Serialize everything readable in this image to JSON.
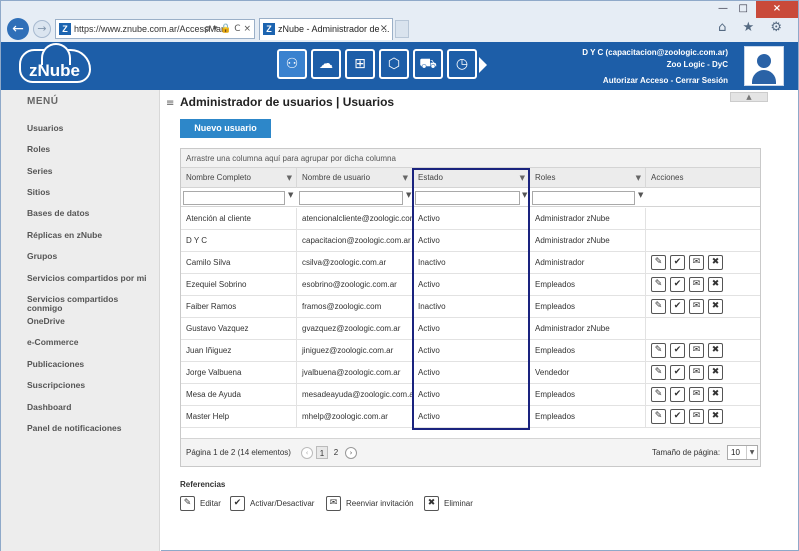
{
  "browser": {
    "url": "https://www.znube.com.ar/AccessMar",
    "tab_title": "zNube - Administrador de ...",
    "tab_close": "×",
    "back": "←",
    "forward": "→",
    "url_controls": "ρ ▾ 🔒 C ×",
    "right_icons": "⌂ ★ ⚙",
    "win_close": "×",
    "win_min": "—",
    "win_max": "□"
  },
  "header": {
    "brand": "zNube",
    "user_email": "D Y C (capacitacion@zoologic.com.ar)",
    "company": "Zoo Logic - DyC",
    "link_authorize": "Autorizar Acceso",
    "link_sep": " - ",
    "link_logout": "Cerrar Sesión",
    "modules": [
      {
        "icon": "users-globe-icon",
        "glyph": "⚇"
      },
      {
        "icon": "cloud-gear-icon",
        "glyph": "☁"
      },
      {
        "icon": "org-chart-icon",
        "glyph": "⊞"
      },
      {
        "icon": "cube-icon",
        "glyph": "⬡"
      },
      {
        "icon": "cart-icon",
        "glyph": "⛟"
      },
      {
        "icon": "clock-icon",
        "glyph": "◷"
      }
    ]
  },
  "sidebar": {
    "title": "MENÚ",
    "items": [
      "Usuarios",
      "Roles",
      "Series",
      "Sitios",
      "Bases de datos",
      "Réplicas en zNube",
      "Grupos",
      "Servicios compartidos por mi",
      "Servicios compartidos conmigo",
      "OneDrive",
      "e-Commerce",
      "Publicaciones",
      "Suscripciones",
      "Dashboard",
      "Panel de notificaciones"
    ]
  },
  "main": {
    "hamburger": "≡",
    "title": "Administrador de usuarios | Usuarios",
    "collapse": "▲",
    "new_user_button": "Nuevo usuario",
    "group_hint": "Arrastre una columna aquí para agrupar por dicha columna",
    "columns": [
      "Nombre Completo",
      "Nombre de usuario",
      "Estado",
      "Roles",
      "Acciones"
    ],
    "filter_icon": "▼",
    "rows": [
      {
        "name": "Atención al cliente",
        "user": "atencionalcliente@zoologic.com.ar",
        "estado": "Activo",
        "rol": "Administrador zNube",
        "actions": false
      },
      {
        "name": "D Y C",
        "user": "capacitacion@zoologic.com.ar",
        "estado": "Activo",
        "rol": "Administrador zNube",
        "actions": false
      },
      {
        "name": "Camilo Silva",
        "user": "csilva@zoologic.com.ar",
        "estado": "Inactivo",
        "rol": "Administrador",
        "actions": true
      },
      {
        "name": "Ezequiel Sobrino",
        "user": "esobrino@zoologic.com.ar",
        "estado": "Activo",
        "rol": "Empleados",
        "actions": true
      },
      {
        "name": "Faiber Ramos",
        "user": "framos@zoologic.com",
        "estado": "Inactivo",
        "rol": "Empleados",
        "actions": true
      },
      {
        "name": "Gustavo Vazquez",
        "user": "gvazquez@zoologic.com.ar",
        "estado": "Activo",
        "rol": "Administrador zNube",
        "actions": false
      },
      {
        "name": "Juan Iñiguez",
        "user": "jiniguez@zoologic.com.ar",
        "estado": "Activo",
        "rol": "Empleados",
        "actions": true
      },
      {
        "name": "Jorge Valbuena",
        "user": "jvalbuena@zoologic.com.ar",
        "estado": "Activo",
        "rol": "Vendedor",
        "actions": true
      },
      {
        "name": "Mesa de Ayuda",
        "user": "mesadeayuda@zoologic.com.ar",
        "estado": "Activo",
        "rol": "Empleados",
        "actions": true
      },
      {
        "name": "Master Help",
        "user": "mhelp@zoologic.com.ar",
        "estado": "Activo",
        "rol": "Empleados",
        "actions": true
      }
    ],
    "action_glyphs": {
      "edit": "✎",
      "toggle": "✔",
      "resend": "✉",
      "delete": "✖"
    },
    "pager": {
      "info": "Página 1 de 2 (14 elementos)",
      "prev": "‹",
      "next": "›",
      "pages": [
        "1",
        "2"
      ],
      "page_size_label": "Tamaño de página:",
      "page_size": "10",
      "page_size_dropdown": "▼"
    },
    "references": {
      "title": "Referencias",
      "items": [
        {
          "key": "edit",
          "label": "Editar"
        },
        {
          "key": "toggle",
          "label": "Activar/Desactivar"
        },
        {
          "key": "resend",
          "label": "Reenviar invitación"
        },
        {
          "key": "delete",
          "label": "Eliminar"
        }
      ]
    }
  },
  "colors": {
    "header_blue": "#1d5ea8",
    "button_blue": "#2d87c9",
    "estado_highlight": "#1a237e"
  }
}
